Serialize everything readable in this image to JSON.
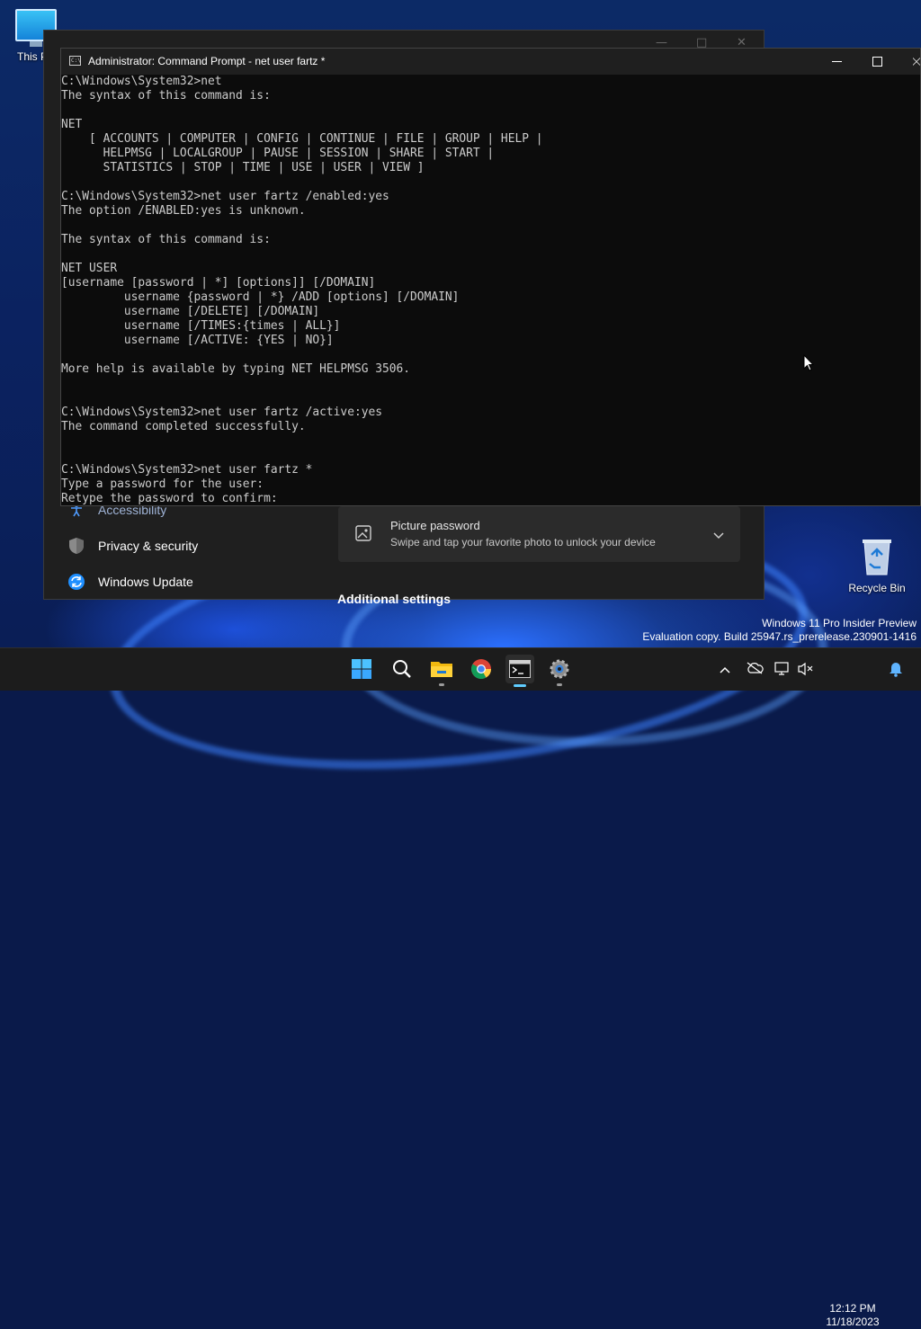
{
  "desktop": {
    "this_pc_label": "This P",
    "recycle_bin_label": "Recycle Bin"
  },
  "settings": {
    "nav": {
      "accessibility": "Accessibility",
      "privacy_security": "Privacy & security",
      "windows_update": "Windows Update"
    },
    "picture_password": {
      "title": "Picture password",
      "description": "Swipe and tap your favorite photo to unlock your device"
    },
    "additional_heading": "Additional settings"
  },
  "cmd": {
    "title": "Administrator: Command Prompt - net  user fartz *",
    "lines": [
      "C:\\Windows\\System32>net",
      "The syntax of this command is:",
      "",
      "NET",
      "    [ ACCOUNTS | COMPUTER | CONFIG | CONTINUE | FILE | GROUP | HELP |",
      "      HELPMSG | LOCALGROUP | PAUSE | SESSION | SHARE | START |",
      "      STATISTICS | STOP | TIME | USE | USER | VIEW ]",
      "",
      "C:\\Windows\\System32>net user fartz /enabled:yes",
      "The option /ENABLED:yes is unknown.",
      "",
      "The syntax of this command is:",
      "",
      "NET USER",
      "[username [password | *] [options]] [/DOMAIN]",
      "         username {password | *} /ADD [options] [/DOMAIN]",
      "         username [/DELETE] [/DOMAIN]",
      "         username [/TIMES:{times | ALL}]",
      "         username [/ACTIVE: {YES | NO}]",
      "",
      "More help is available by typing NET HELPMSG 3506.",
      "",
      "",
      "C:\\Windows\\System32>net user fartz /active:yes",
      "The command completed successfully.",
      "",
      "",
      "C:\\Windows\\System32>net user fartz *",
      "Type a password for the user:",
      "Retype the password to confirm:"
    ]
  },
  "watermark": {
    "line1": "Windows 11 Pro Insider Preview",
    "line2": "Evaluation copy. Build 25947.rs_prerelease.230901-1416"
  },
  "taskbar": {
    "time": "12:12 PM",
    "date": "11/18/2023",
    "icons": [
      "start-icon",
      "search-icon",
      "file-explorer-icon",
      "chrome-icon",
      "terminal-icon",
      "settings-icon"
    ]
  },
  "colors": {
    "terminal_bg": "#0c0c0c",
    "terminal_text": "#cccccc",
    "accent": "#60cdff",
    "taskbar_bg": "#1c1c1c"
  }
}
